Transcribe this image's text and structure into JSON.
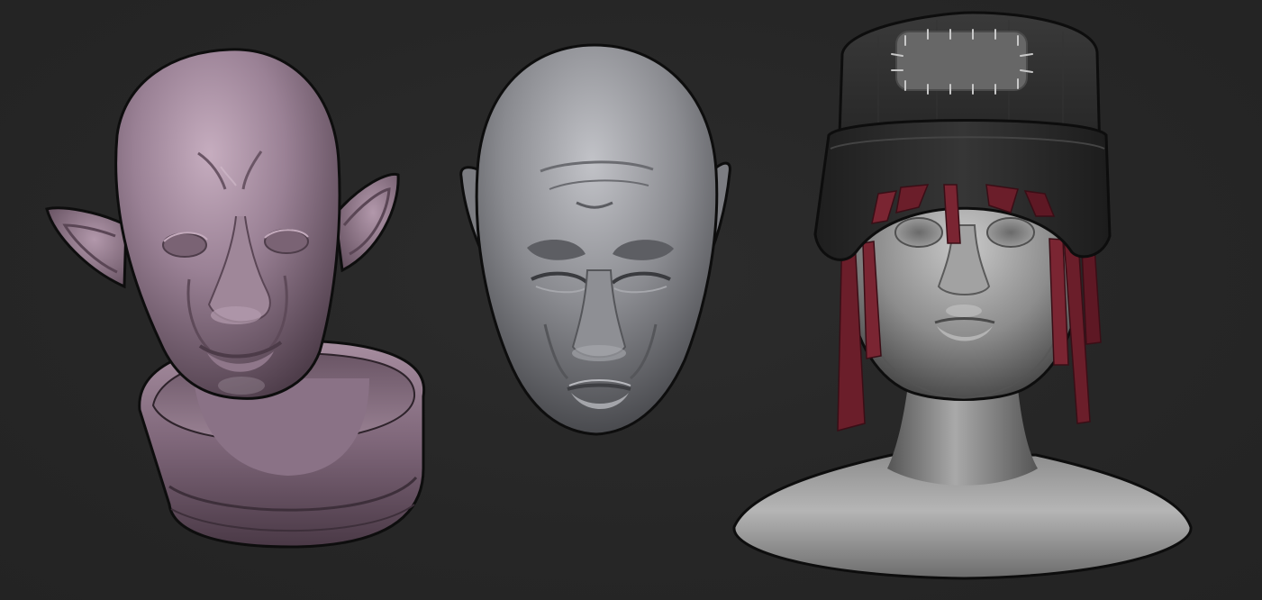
{
  "scene": {
    "background_color": "#272727",
    "outline_color": "#0d0d0d",
    "sculpts": [
      {
        "id": "elf-bust",
        "material": "purple-clay",
        "color_base": "#8e7688",
        "color_light": "#c0a6b9",
        "color_dark": "#4c3b48"
      },
      {
        "id": "orc-face",
        "material": "grey-clay",
        "color_base": "#7f8085",
        "color_light": "#b6b7bc",
        "color_dark": "#3e3f43"
      },
      {
        "id": "beanie-bust",
        "material": "grey-clay",
        "color_base": "#7c7c7c",
        "color_light": "#bdbdbd",
        "color_dark": "#383838",
        "hat_color": "#2b2b2b",
        "patch_color": "#666666",
        "hair_color": "#6b1e2a"
      }
    ]
  }
}
